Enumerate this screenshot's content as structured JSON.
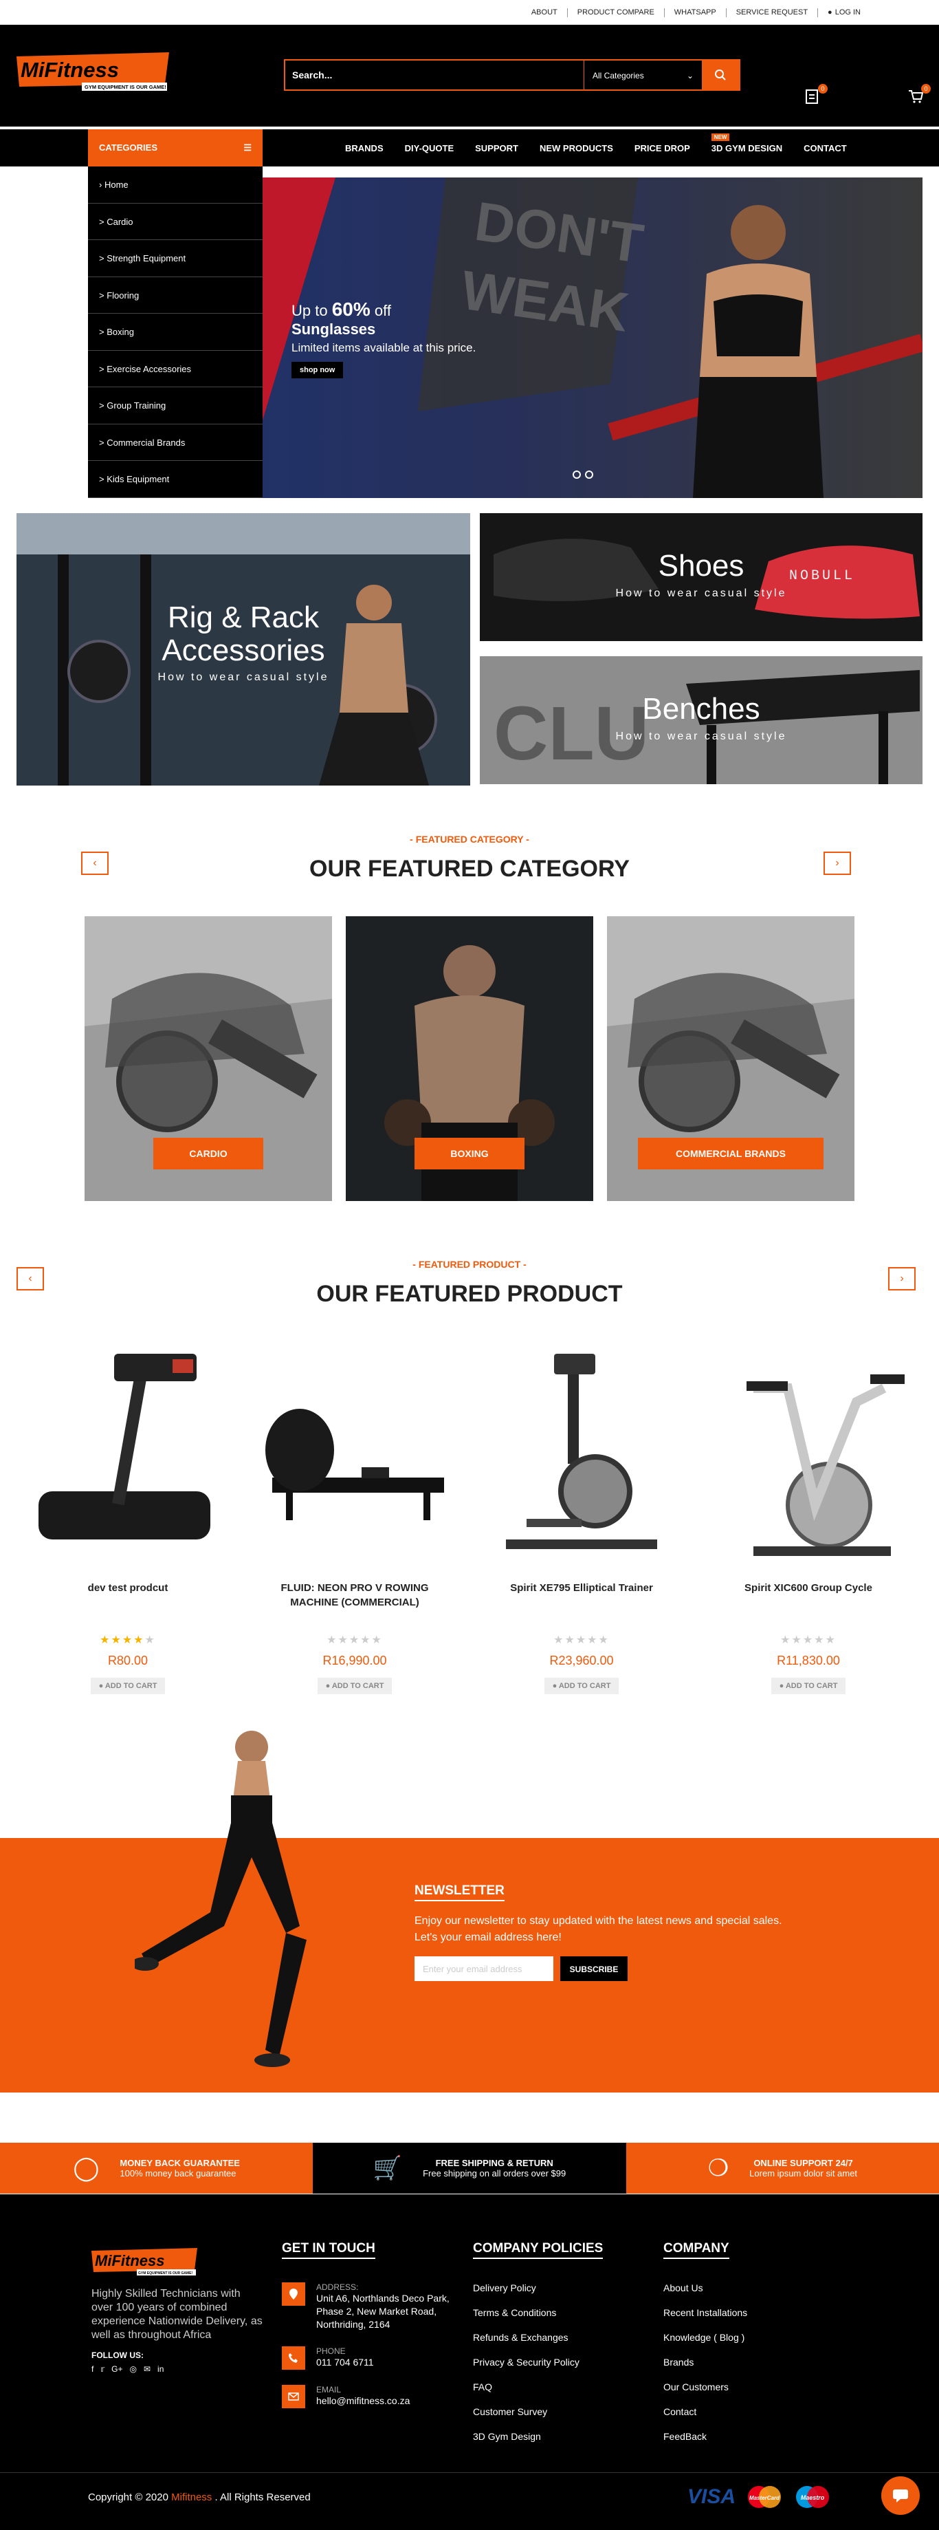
{
  "topbar": {
    "links": [
      "ABOUT",
      "PRODUCT COMPARE",
      "WHATSAPP",
      "SERVICE REQUEST",
      "LOG IN"
    ]
  },
  "header": {
    "logo_text": "MiFitness",
    "logo_tagline": "GYM EQUIPMENT IS OUR GAME!",
    "search_placeholder": "Search...",
    "category_select": "All Categories",
    "compare_count": "0",
    "cart_count": "0"
  },
  "nav": {
    "categories_label": "CATEGORIES",
    "items": [
      "BRANDS",
      "DIY-QUOTE",
      "SUPPORT",
      "NEW PRODUCTS",
      "PRICE DROP",
      "3D GYM DESIGN",
      "CONTACT"
    ],
    "new_badge": "NEW"
  },
  "sidebar": {
    "items": [
      "Home",
      "Cardio",
      "Strength Equipment",
      "Flooring",
      "Boxing",
      "Exercise Accessories",
      "Group Training",
      "Commercial Brands",
      "Kids Equipment"
    ]
  },
  "hero": {
    "up_to": "Up to",
    "percent": "60%",
    "off": "off",
    "product": "Sunglasses",
    "limited": "Limited items available at this price.",
    "cta": "shop now"
  },
  "tiles": [
    {
      "title": "Rig & Rack Accessories",
      "subtitle": "How to wear casual style"
    },
    {
      "title": "Shoes",
      "subtitle": "How to wear casual style"
    },
    {
      "title": "Benches",
      "subtitle": "How to wear casual style"
    }
  ],
  "featured_category": {
    "sub": "- FEATURED CATEGORY -",
    "title": "OUR FEATURED CATEGORY",
    "cards": [
      "CARDIO",
      "BOXING",
      "COMMERCIAL BRANDS"
    ]
  },
  "featured_product": {
    "sub": "- FEATURED PRODUCT -",
    "title": "OUR FEATURED PRODUCT",
    "cart_label": "ADD TO CART",
    "products": [
      {
        "name": "dev test prodcut",
        "price": "R80.00",
        "rating": 4
      },
      {
        "name": "FLUID: NEON PRO V ROWING MACHINE (COMMERCIAL)",
        "price": "R16,990.00",
        "rating": 0
      },
      {
        "name": "Spirit XE795 Elliptical Trainer",
        "price": "R23,960.00",
        "rating": 0
      },
      {
        "name": "Spirit XIC600 Group Cycle",
        "price": "R11,830.00",
        "rating": 0
      }
    ]
  },
  "newsletter": {
    "title": "NEWSLETTER",
    "text1": "Enjoy our newsletter to stay updated with the latest news and special sales.",
    "text2": "Let's your email address here!",
    "placeholder": "Enter your email address",
    "button": "SUBSCRIBE"
  },
  "features": [
    {
      "title": "MONEY BACK GUARANTEE",
      "text": "100% money back guarantee"
    },
    {
      "title": "FREE SHIPPING & RETURN",
      "text": "Free shipping on all orders over $99"
    },
    {
      "title": "ONLINE SUPPORT 24/7",
      "text": "Lorem ipsum dolor sit amet"
    }
  ],
  "footer": {
    "about": "Highly Skilled Technicians with over 100 years of combined experience Nationwide Delivery, as well as throughout Africa",
    "follow": "FOLLOW US:",
    "get_in_touch": "GET IN TOUCH",
    "address_label": "ADDRESS:",
    "address": "Unit A6, Northlands Deco Park, Phase 2, New Market Road, Northriding, 2164",
    "phone_label": "PHONE",
    "phone": "011 704 6711",
    "email_label": "EMAIL",
    "email": "hello@mifitness.co.za",
    "policies_title": "COMPANY POLICIES",
    "policies": [
      "Delivery Policy",
      "Terms & Conditions",
      "Refunds & Exchanges",
      "Privacy & Security Policy",
      "FAQ",
      "Customer Survey",
      "3D Gym Design"
    ],
    "company_title": "COMPANY",
    "company": [
      "About Us",
      "Recent Installations",
      "Knowledge ( Blog )",
      "Brands",
      "Our Customers",
      "Contact",
      "FeedBack"
    ],
    "copyright_pre": "Copyright © 2020",
    "copyright_brand": "Mifitness",
    "copyright_post": ". All Rights Reserved",
    "payment": [
      "VISA",
      "MasterCard",
      "Maestro"
    ]
  },
  "colors": {
    "accent": "#f05a0c",
    "dark": "#000000"
  }
}
